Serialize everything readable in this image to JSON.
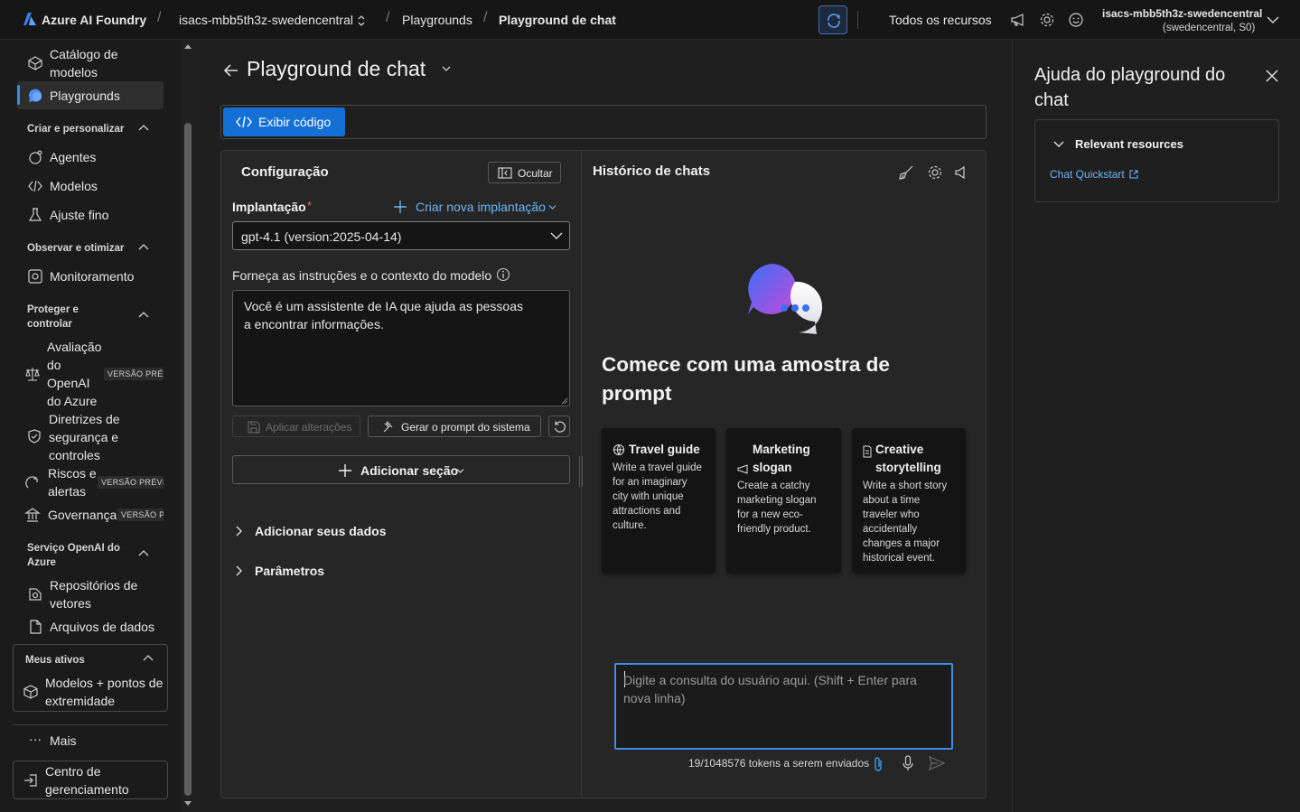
{
  "topbar": {
    "brand": "Azure AI Foundry",
    "project": "isacs-mbb5th3z-swedencentral",
    "crumb_playgrounds": "Playgrounds",
    "crumb_current": "Playground de chat",
    "all_resources": "Todos os recursos",
    "account_name": "isacs-mbb5th3z-swedencentral",
    "account_sub": "(swedencentral, S0)"
  },
  "nav": {
    "catalog": "Catálogo de modelos",
    "playgrounds": "Playgrounds",
    "sec_create": "Criar e personalizar",
    "agents": "Agentes",
    "models": "Modelos",
    "finetune": "Ajuste fino",
    "sec_observe": "Observar e otimizar",
    "monitoring": "Monitoramento",
    "sec_protect": "Proteger e controlar",
    "eval": "Avaliação do OpenAI do Azure",
    "eval_badge": "VERSÃO PRÉVIA",
    "guidelines": "Diretrizes de segurança e controles",
    "risks": "Riscos e alertas",
    "risks_badge": "VERSÃO PRÉVIA",
    "governance": "Governança",
    "governance_badge": "VERSÃO PR",
    "sec_openai": "Serviço OpenAI do Azure",
    "vector": "Repositórios de vetores",
    "datafiles": "Arquivos de dados",
    "sec_assets": "Meus ativos",
    "models_endpoints": "Modelos + pontos de extremidade",
    "more": "Mais",
    "mgmt": "Centro de gerenciamento"
  },
  "main": {
    "title": "Playground de chat",
    "view_code": "Exibir código",
    "config_title": "Configuração",
    "hide": "Ocultar",
    "deployment_label": "Implantação",
    "required_mark": "*",
    "create_deployment": "Criar nova implantação",
    "deployment_value": "gpt-4.1 (version:2025-04-14)",
    "instructions_label": "Forneça as instruções e o contexto do modelo",
    "instructions_value": "Você é um assistente de IA que ajuda as pessoas a encontrar informações.",
    "apply_changes": "Aplicar alterações",
    "generate_prompt": "Gerar o prompt do sistema",
    "add_section": "Adicionar seção",
    "add_data": "Adicionar seus dados",
    "parameters": "Parâmetros"
  },
  "chat": {
    "history_title": "Histórico de chats",
    "headline": "Comece com uma amostra de prompt",
    "cards": [
      {
        "title": "Travel guide",
        "desc": "Write a travel guide for an imaginary city with unique attractions and culture."
      },
      {
        "title": "Marketing slogan",
        "desc": "Create a catchy marketing slogan for a new eco-friendly product."
      },
      {
        "title": "Creative storytelling",
        "desc": "Write a short story about a time traveler who accidentally changes a major historical event."
      }
    ],
    "input_placeholder": "Digite a consulta do usuário aqui. (Shift + Enter para nova linha)",
    "tokens": "19/1048576 tokens a serem enviados"
  },
  "help": {
    "title": "Ajuda do playground do chat",
    "section": "Relevant resources",
    "link": "Chat Quickstart"
  },
  "colors": {
    "accent": "#1570d6",
    "link": "#6cb4f6",
    "focus_border": "#3a8ee6"
  }
}
